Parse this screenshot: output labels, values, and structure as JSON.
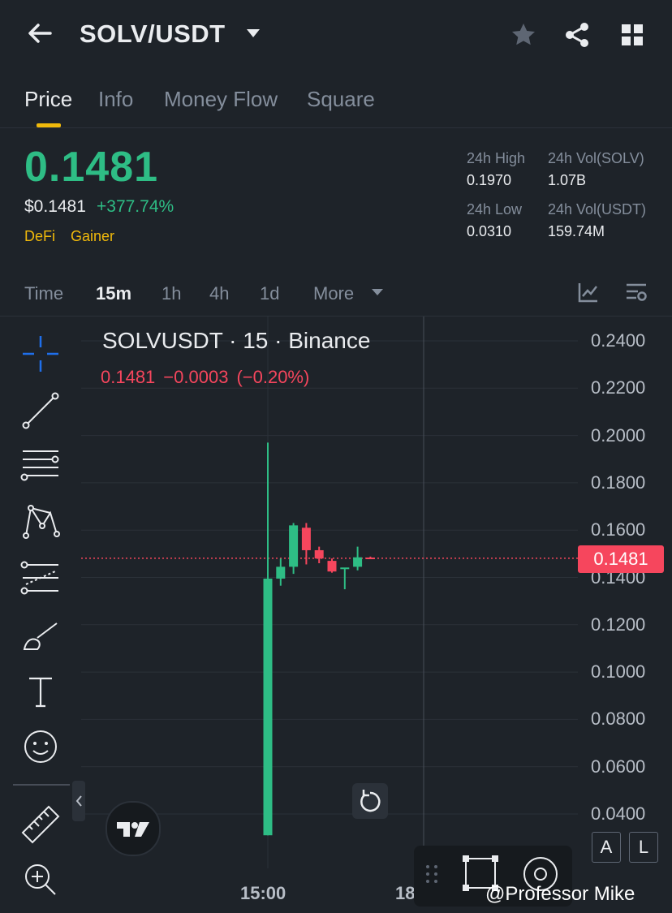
{
  "header": {
    "pair": "SOLV/USDT",
    "icons": [
      "back-arrow-icon",
      "chevron-down-icon",
      "star-icon",
      "share-icon",
      "grid-icon"
    ]
  },
  "tabs": [
    "Price",
    "Info",
    "Money Flow",
    "Square"
  ],
  "price": {
    "last": "0.1481",
    "usd": "$0.1481",
    "change_pct": "+377.74%",
    "tags": [
      "DeFi",
      "Gainer"
    ]
  },
  "stats": [
    {
      "label": "24h High",
      "value": "0.1970"
    },
    {
      "label": "24h Vol(SOLV)",
      "value": "1.07B"
    },
    {
      "label": "24h Low",
      "value": "0.0310"
    },
    {
      "label": "24h Vol(USDT)",
      "value": "159.74M"
    }
  ],
  "intervals": [
    "Time",
    "15m",
    "1h",
    "4h",
    "1d",
    "More"
  ],
  "chart": {
    "legend": "SOLVUSDT · 15 · Binance",
    "legend_values": [
      "0.1481",
      "−0.0003",
      "(−0.20%)"
    ],
    "current_price_label": "0.1481",
    "y_ticks": [
      "0.2400",
      "0.2200",
      "0.2000",
      "0.1800",
      "0.1600",
      "0.1400",
      "0.1200",
      "0.1000",
      "0.0800",
      "0.0600",
      "0.0400"
    ],
    "x_labels": [
      "15:00",
      "18"
    ],
    "scale_buttons": [
      "A",
      "L"
    ]
  },
  "chart_data": {
    "type": "candlestick",
    "ylim": [
      0.03,
      0.25
    ],
    "y_ticks": [
      0.24,
      0.22,
      0.2,
      0.18,
      0.16,
      0.14,
      0.12,
      0.1,
      0.08,
      0.06,
      0.04
    ],
    "last_price": 0.1481,
    "candles": [
      {
        "o": 0.031,
        "h": 0.197,
        "l": 0.031,
        "c": 0.1395,
        "up": true
      },
      {
        "o": 0.1395,
        "h": 0.148,
        "l": 0.1365,
        "c": 0.1445,
        "up": true
      },
      {
        "o": 0.1445,
        "h": 0.163,
        "l": 0.1415,
        "c": 0.162,
        "up": true
      },
      {
        "o": 0.161,
        "h": 0.163,
        "l": 0.1455,
        "c": 0.1515,
        "up": false
      },
      {
        "o": 0.1515,
        "h": 0.153,
        "l": 0.146,
        "c": 0.148,
        "up": false
      },
      {
        "o": 0.147,
        "h": 0.148,
        "l": 0.142,
        "c": 0.1425,
        "up": false
      },
      {
        "o": 0.1435,
        "h": 0.144,
        "l": 0.135,
        "c": 0.1442,
        "up": true
      },
      {
        "o": 0.1445,
        "h": 0.153,
        "l": 0.143,
        "c": 0.1485,
        "up": true
      },
      {
        "o": 0.1484,
        "h": 0.1488,
        "l": 0.1478,
        "c": 0.1481,
        "up": false
      }
    ]
  },
  "toolbar": [
    "crosshair-icon",
    "trend-line-icon",
    "fib-icon",
    "pattern-icon",
    "projection-icon",
    "brush-icon",
    "text-icon",
    "emoji-icon",
    "ruler-icon",
    "zoom-in-icon"
  ],
  "watermark": "@Professor Mike"
}
